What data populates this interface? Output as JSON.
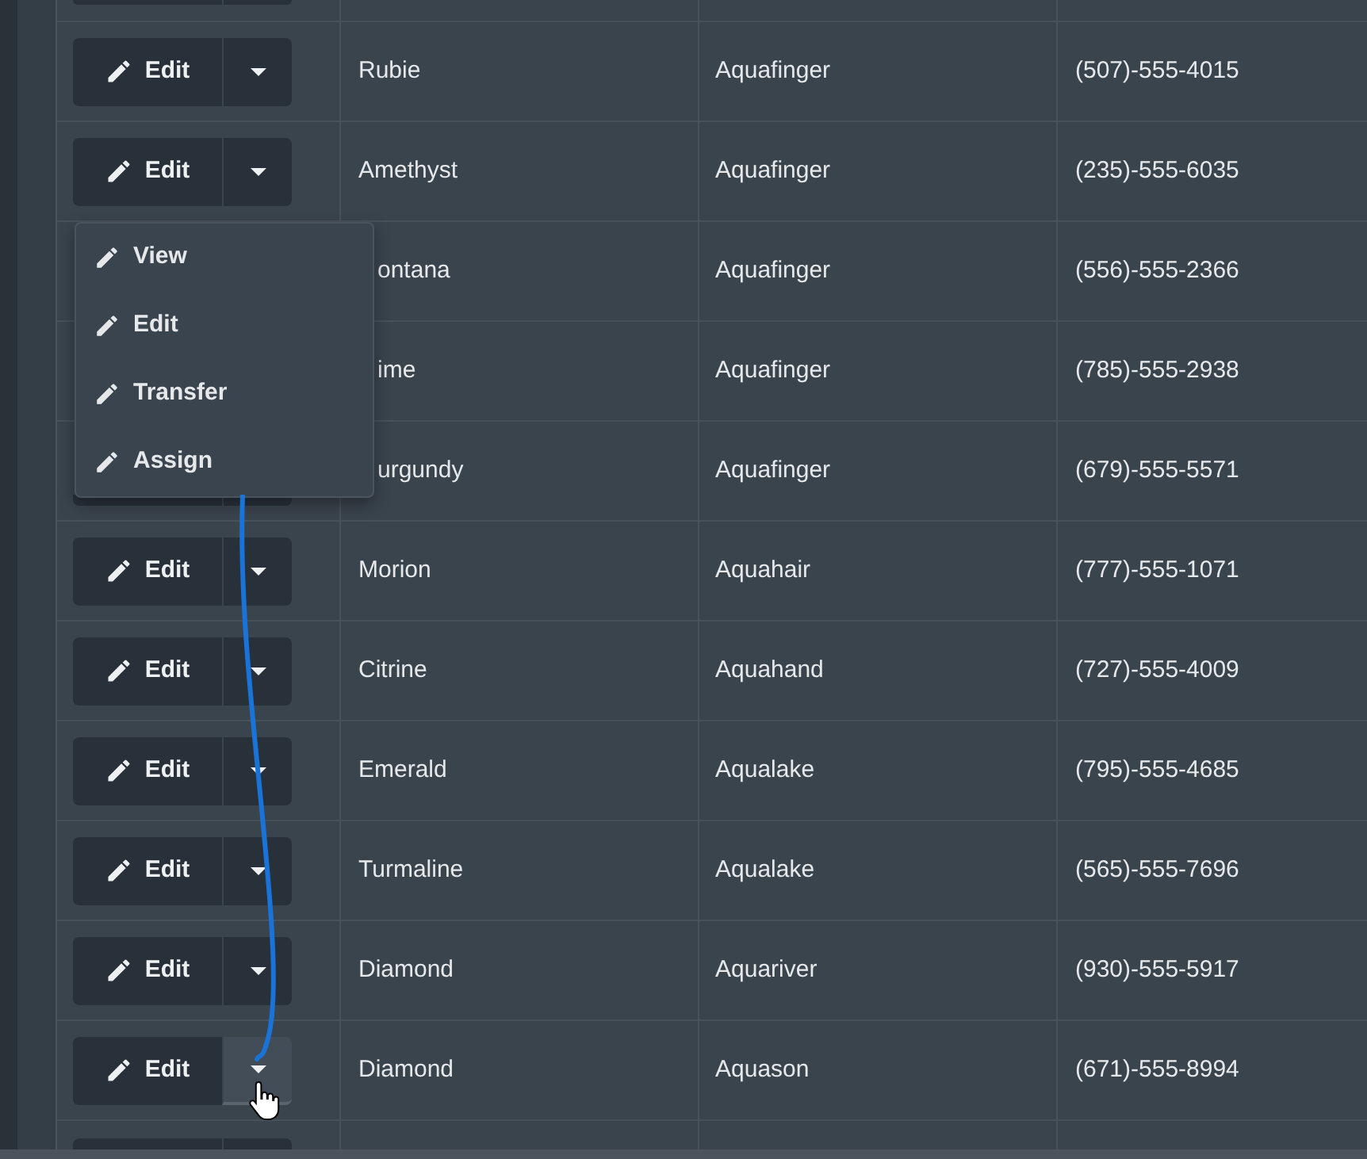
{
  "table": {
    "rows": [
      {
        "column_1": {
          "button": "Edit",
          "menu_open": false,
          "caret_hovered": false
        },
        "column_2": "Rubie",
        "column_3": "Aquafinger",
        "column_4": "(507)-555-4015"
      },
      {
        "column_1": {
          "button": "Edit",
          "menu_open": true,
          "caret_hovered": false
        },
        "column_2": "Amethyst",
        "column_3": "Aquafinger",
        "column_4": "(235)-555-6035"
      },
      {
        "column_2": "ontana",
        "column_3": "Aquafinger",
        "column_4": "(556)-555-2366"
      },
      {
        "column_2": "ime",
        "column_3": "Aquafinger",
        "column_4": "(785)-555-2938"
      },
      {
        "column_2": "urgundy",
        "column_3": "Aquafinger",
        "column_4": "(679)-555-5571"
      },
      {
        "column_1": {
          "button": "Edit",
          "menu_open": false,
          "caret_hovered": false
        },
        "column_2": "Morion",
        "column_3": "Aquahair",
        "column_4": "(777)-555-1071"
      },
      {
        "column_1": {
          "button": "Edit",
          "menu_open": false,
          "caret_hovered": false
        },
        "column_2": "Citrine",
        "column_3": "Aquahand",
        "column_4": "(727)-555-4009"
      },
      {
        "column_1": {
          "button": "Edit",
          "menu_open": false,
          "caret_hovered": false
        },
        "column_2": "Emerald",
        "column_3": "Aqualake",
        "column_4": "(795)-555-4685"
      },
      {
        "column_1": {
          "button": "Edit",
          "menu_open": false,
          "caret_hovered": false
        },
        "column_2": "Turmaline",
        "column_3": "Aqualake",
        "column_4": "(565)-555-7696"
      },
      {
        "column_1": {
          "button": "Edit",
          "menu_open": false,
          "caret_hovered": false
        },
        "column_2": "Diamond",
        "column_3": "Aquariver",
        "column_4": "(930)-555-5917"
      },
      {
        "column_1": {
          "button": "Edit",
          "menu_open": false,
          "caret_hovered": true
        },
        "column_2": "Diamond",
        "column_3": "Aquason",
        "column_4": "(671)-555-8994"
      }
    ]
  },
  "dropdown_menu": {
    "items": [
      {
        "label": "View"
      },
      {
        "label": "Edit"
      },
      {
        "label": "Transfer"
      },
      {
        "label": "Assign"
      }
    ]
  }
}
